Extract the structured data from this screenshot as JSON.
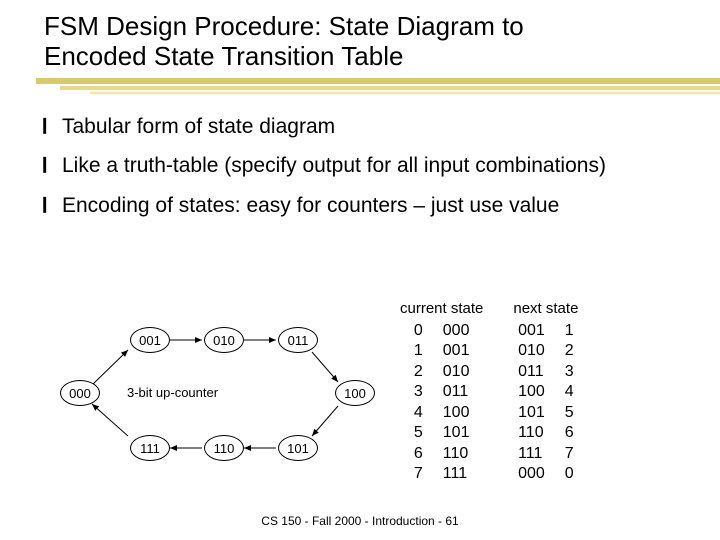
{
  "title_line1": "FSM Design Procedure: State Diagram to",
  "title_line2": "Encoded State Transition Table",
  "bullets": [
    "Tabular form of state diagram",
    "Like a truth-table (specify output for all input combinations)",
    "Encoding of states: easy for counters – just use value"
  ],
  "diagram": {
    "caption": "3-bit up-counter",
    "states": [
      "000",
      "001",
      "010",
      "011",
      "100",
      "101",
      "110",
      "111"
    ]
  },
  "table": {
    "headers": {
      "current": "current state",
      "next": "next state"
    },
    "current_dec": [
      "0",
      "1",
      "2",
      "3",
      "4",
      "5",
      "6",
      "7"
    ],
    "current_bin": [
      "000",
      "001",
      "010",
      "011",
      "100",
      "101",
      "110",
      "111"
    ],
    "next_bin": [
      "001",
      "010",
      "011",
      "100",
      "101",
      "110",
      "111",
      "000"
    ],
    "next_dec": [
      "1",
      "2",
      "3",
      "4",
      "5",
      "6",
      "7",
      "0"
    ]
  },
  "footer": "CS 150 - Fall 2000 - Introduction - 61"
}
